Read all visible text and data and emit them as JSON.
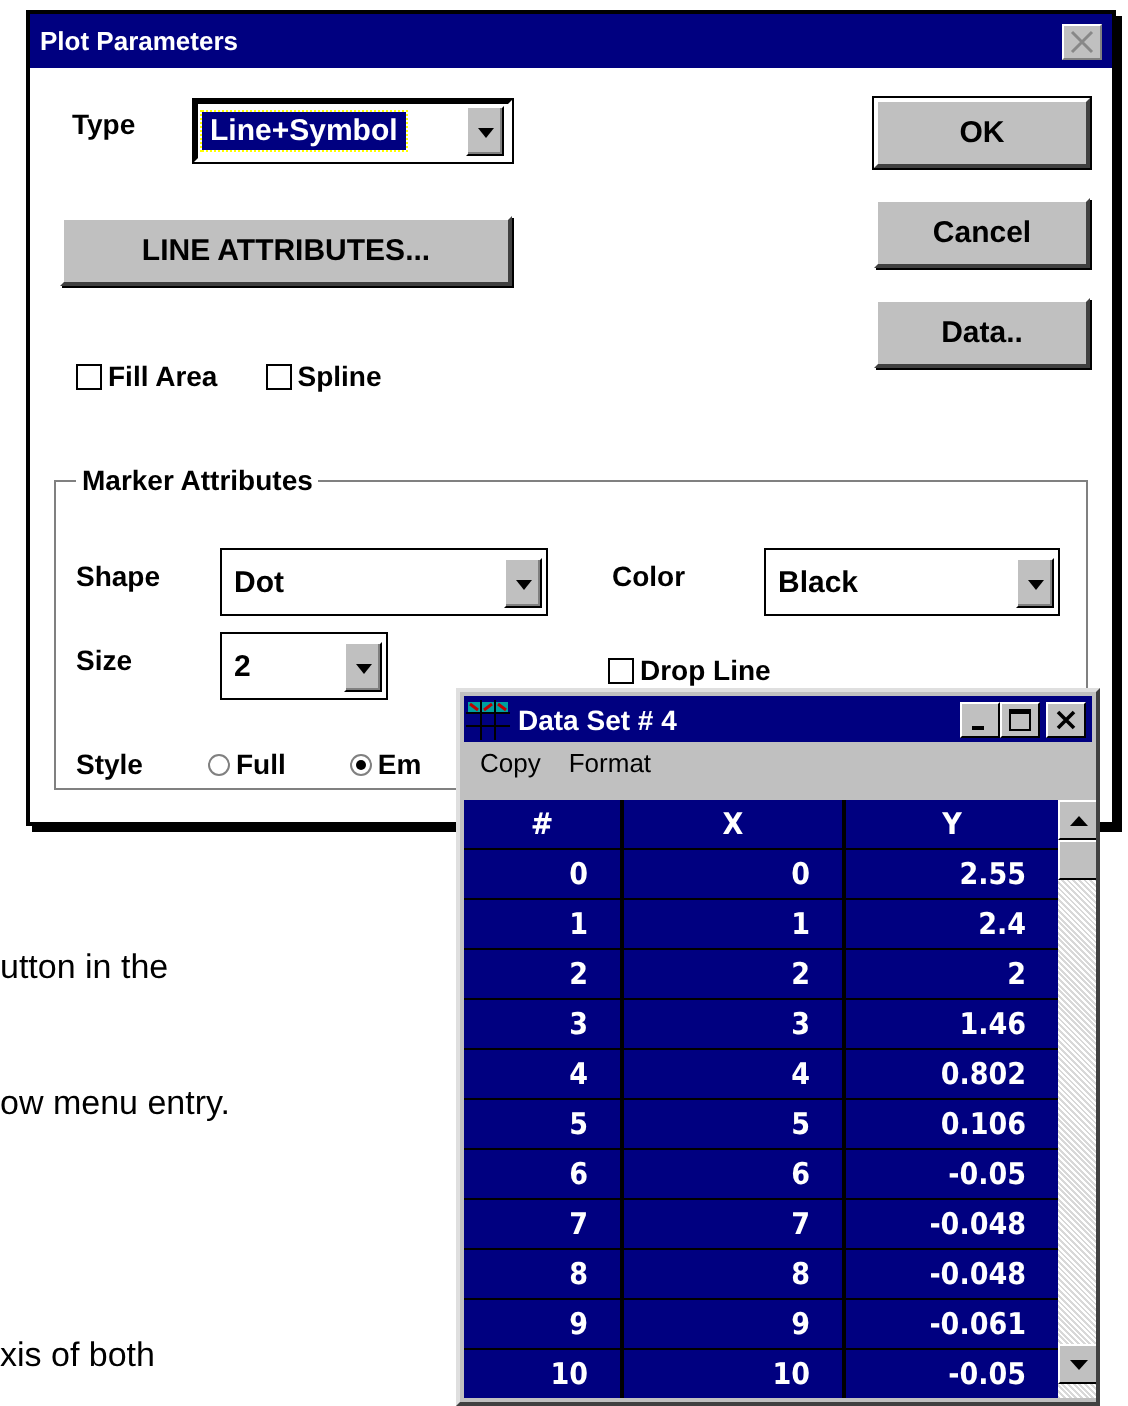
{
  "document": {
    "lines": [
      "utton in the",
      "ow menu entry.",
      "xis of both"
    ]
  },
  "dialog": {
    "title": "Plot Parameters",
    "type": {
      "label": "Type",
      "value": "Line+Symbol"
    },
    "line_attributes_button": {
      "label": "LINE ATTRIBUTES..."
    },
    "buttons": [
      {
        "label": "OK"
      },
      {
        "label": "Cancel"
      },
      {
        "label": "Data.."
      }
    ],
    "options": [
      {
        "label": "Fill Area",
        "checked": false
      },
      {
        "label": "Spline",
        "checked": false
      }
    ],
    "marker_attributes": {
      "title": "Marker Attributes",
      "shape": {
        "label": "Shape",
        "value": "Dot"
      },
      "color": {
        "label": "Color",
        "value": "Black"
      },
      "size": {
        "label": "Size",
        "value": "2"
      },
      "drop_line": {
        "label": "Drop Line",
        "checked": false
      },
      "style": {
        "label": "Style",
        "options": [
          {
            "label": "Full",
            "selected": false
          },
          {
            "label": "Em",
            "selected": true
          }
        ]
      }
    }
  },
  "data_window": {
    "title": "Data Set # 4",
    "menu": [
      {
        "label": "Copy"
      },
      {
        "label": "Format"
      }
    ],
    "table": {
      "columns": [
        "#",
        "X",
        "Y"
      ],
      "rows": [
        [
          "0",
          "0",
          "2.55"
        ],
        [
          "1",
          "1",
          "2.4"
        ],
        [
          "2",
          "2",
          "2"
        ],
        [
          "3",
          "3",
          "1.46"
        ],
        [
          "4",
          "4",
          "0.802"
        ],
        [
          "5",
          "5",
          "0.106"
        ],
        [
          "6",
          "6",
          "-0.05"
        ],
        [
          "7",
          "7",
          "-0.048"
        ],
        [
          "8",
          "8",
          "-0.048"
        ],
        [
          "9",
          "9",
          "-0.061"
        ],
        [
          "10",
          "10",
          "-0.05"
        ]
      ]
    }
  }
}
